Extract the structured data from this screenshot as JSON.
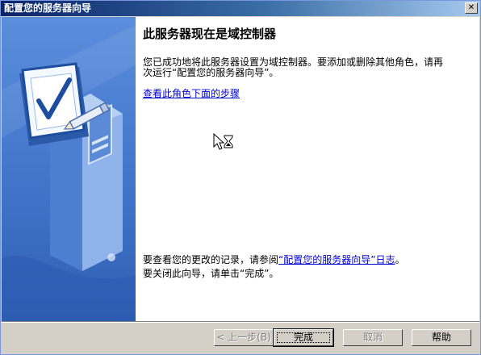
{
  "window": {
    "title": "配置您的服务器向导",
    "close_label": "✕"
  },
  "main": {
    "heading": "此服务器现在是域控制器",
    "description": "您已成功地将此服务器设置为域控制器。要添加或删除其他角色，请再次运行“配置您的服务器向导”。",
    "role_link": "查看此角色下面的步骤",
    "log_prefix": "要查看您的更改的记录，请参阅",
    "log_link": "“配置您的服务器向导”日志",
    "log_suffix": "。",
    "close_hint": "要关闭此向导，请单击“完成”。"
  },
  "buttons": {
    "back": "< 上一步(B)",
    "finish": "完成",
    "cancel": "取消",
    "help": "帮助"
  },
  "colors": {
    "title_start": "#0a246a",
    "title_end": "#a6caf0",
    "side_panel": "#3f72c8",
    "link": "#0000cc"
  },
  "icons": {
    "side": "checklist-document-pencil-icon",
    "cursor": "hourglass-arrow-cursor-icon"
  }
}
